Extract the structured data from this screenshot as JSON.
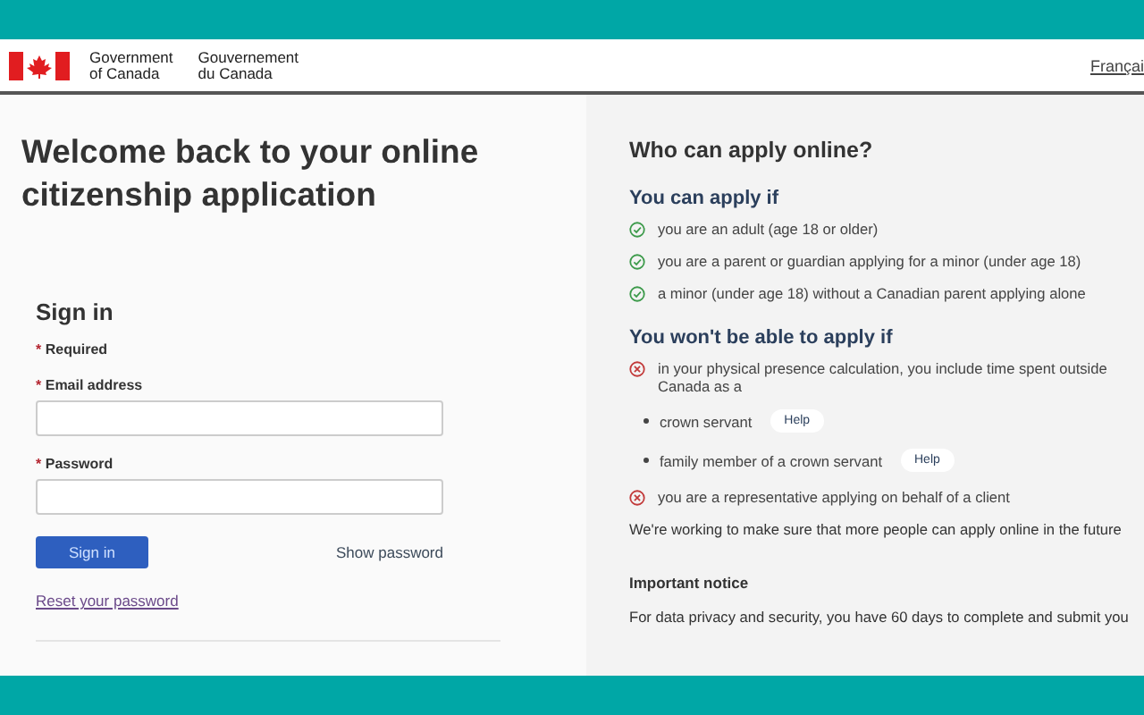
{
  "header": {
    "government_en": [
      "Government",
      "of Canada"
    ],
    "government_fr": [
      "Gouvernement",
      "du Canada"
    ],
    "language_link": "Françai"
  },
  "sign_in_panel": {
    "title": "Welcome back to your online citizenship application",
    "heading": "Sign in",
    "required_mark": "*",
    "required_note": "Required",
    "fields": [
      {
        "required_mark": "*",
        "label": "Email address"
      },
      {
        "required_mark": "*",
        "label": "Password"
      }
    ],
    "sign_in_button": "Sign in",
    "show_password": "Show password",
    "reset_link": "Reset your password"
  },
  "eligibility": {
    "title": "Who can apply online?",
    "sections": [
      {
        "heading": "You can apply if",
        "items": [
          {
            "kind": "eligible",
            "text": "you are an adult (age 18 or older)"
          },
          {
            "kind": "eligible",
            "text": "you are a parent or guardian applying for a minor (under age 18)"
          },
          {
            "kind": "eligible",
            "text": "a minor (under age 18) without a Canadian parent applying alone"
          }
        ]
      },
      {
        "heading": "You won't be able to apply if",
        "items": [
          {
            "kind": "ineligible",
            "text": "in your physical presence calculation, you include time spent outside Canada as a"
          },
          {
            "kind": "bullet",
            "text": "crown servant",
            "help": "Help"
          },
          {
            "kind": "bullet",
            "text": "family member of a crown servant",
            "help": "Help"
          },
          {
            "kind": "ineligible",
            "text": "you are a representative applying on behalf of a client"
          }
        ]
      }
    ],
    "note": "We're working to make sure that more people can apply online in the future",
    "notice_heading": "Important notice",
    "notice_text": "For data privacy and security, you have 60 days to complete and submit you"
  }
}
